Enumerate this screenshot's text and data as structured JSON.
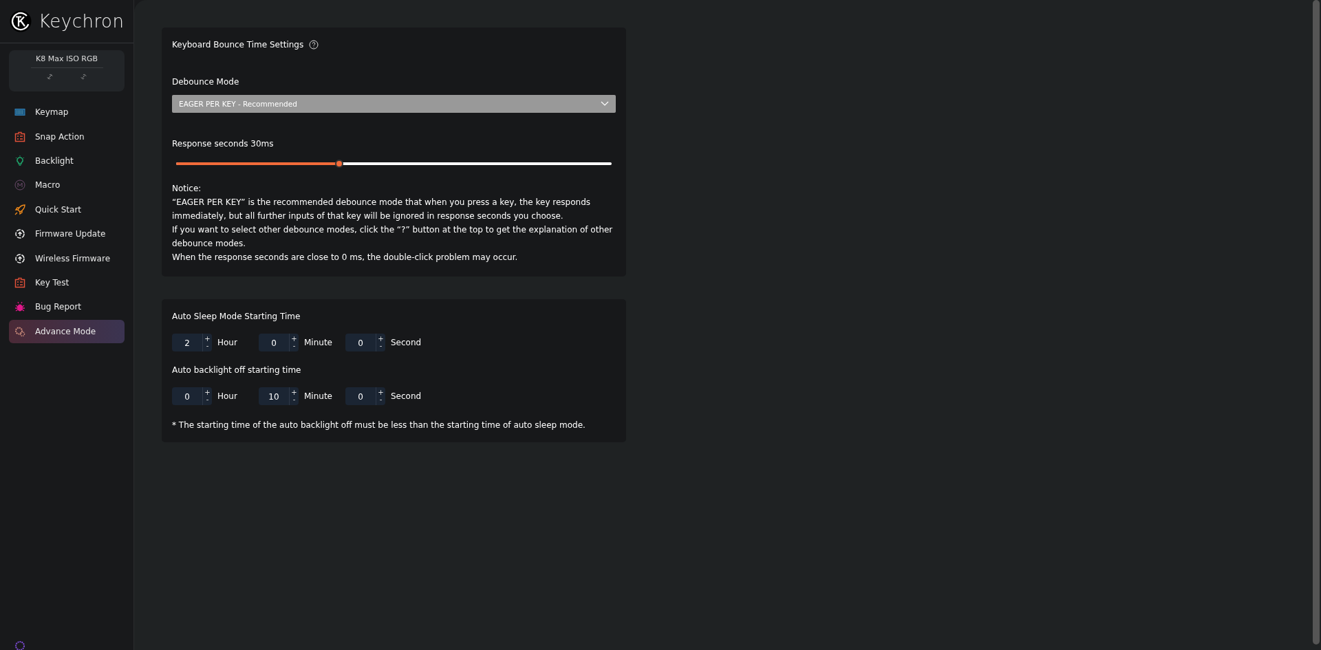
{
  "sidebar": {
    "brand": "Keychron",
    "device": {
      "name": "K8 Max ISO RGB"
    },
    "items": [
      {
        "label": "Keymap",
        "kind": "keyboard",
        "selected": false
      },
      {
        "label": "Snap Action",
        "kind": "toolbox",
        "selected": false
      },
      {
        "label": "Backlight",
        "kind": "bulb",
        "selected": false
      },
      {
        "label": "Macro",
        "kind": "macro",
        "selected": false
      },
      {
        "label": "Quick Start",
        "kind": "rocket",
        "selected": false
      },
      {
        "label": "Firmware Update",
        "kind": "chip",
        "selected": false
      },
      {
        "label": "Wireless Firmware",
        "kind": "chip",
        "selected": false
      },
      {
        "label": "Key Test",
        "kind": "toolbox",
        "selected": false
      },
      {
        "label": "Bug Report",
        "kind": "bug",
        "selected": false
      },
      {
        "label": "Advance Mode",
        "kind": "gears",
        "selected": true
      }
    ]
  },
  "debounce": {
    "title": "Keyboard Bounce Time Settings",
    "mode_label": "Debounce Mode",
    "mode": "EAGER PER KEY - Recommended",
    "response_label": "Response seconds 30ms",
    "level": 0.374,
    "notice": [
      "Notice:",
      "“EAGER PER KEY” is the recommended debounce mode that when you press a key, the key responds immediately, but all further inputs of that key will be ignored in response seconds you choose.",
      "If you want to select other debounce modes, click the “?” button at the top to get the explanation of other debounce modes.",
      "When the response seconds are close to 0 ms, the double-click problem may occur."
    ]
  },
  "sleep": {
    "groups": [
      {
        "title": "Auto Sleep Mode Starting Time",
        "fields": [
          {
            "value": "2",
            "unit": "Hour"
          },
          {
            "value": "0",
            "unit": "Minute"
          },
          {
            "value": "0",
            "unit": "Second"
          }
        ]
      },
      {
        "title": "Auto backlight off starting time",
        "fields": [
          {
            "value": "0",
            "unit": "Hour"
          },
          {
            "value": "10",
            "unit": "Minute"
          },
          {
            "value": "0",
            "unit": "Second"
          }
        ]
      }
    ],
    "plus": "+",
    "minus": "-",
    "note": "* The starting time of the auto backlight off must be less than the starting time of auto sleep mode."
  }
}
